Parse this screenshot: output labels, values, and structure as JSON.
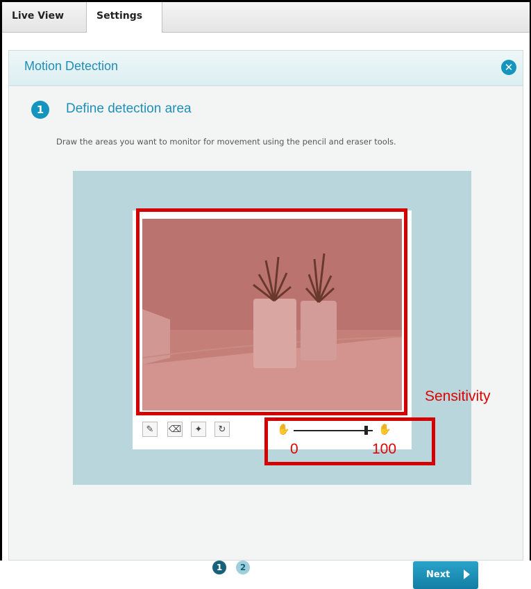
{
  "tabs": [
    {
      "label": "Live View"
    },
    {
      "label": "Settings"
    }
  ],
  "panel": {
    "title": "Motion Detection",
    "close_icon": "close-icon"
  },
  "step": {
    "number": "1",
    "title": "Define detection area",
    "description": "Draw the areas you want to monitor for movement using the pencil and eraser tools."
  },
  "tools": {
    "pencil_icon": "pencil-icon",
    "eraser_icon": "eraser-icon",
    "brush_icon": "brush-clear-icon",
    "reset_icon": "refresh-icon"
  },
  "sensitivity": {
    "label": "Sensitivity",
    "min_label": "0",
    "max_label": "100",
    "value_percent": 88
  },
  "pager": {
    "page1": "1",
    "page2": "2"
  },
  "next_button": {
    "label": "Next"
  },
  "colors": {
    "accent": "#1594bd",
    "highlight_red": "#d40000",
    "preview_bg": "#b8d6db"
  }
}
